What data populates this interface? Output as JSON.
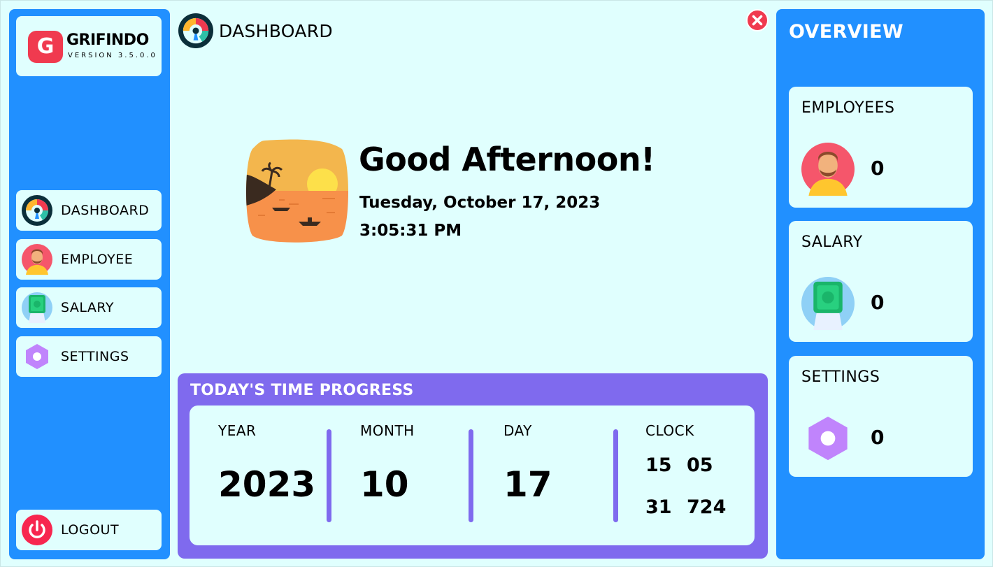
{
  "app": {
    "logo_letter": "G",
    "name": "GRIFINDO",
    "version": "VERSION 3.5.0.0"
  },
  "sidebar": {
    "items": [
      {
        "label": "DASHBOARD",
        "icon": "dashboard-gauge-icon"
      },
      {
        "label": "EMPLOYEE",
        "icon": "employee-avatar-icon"
      },
      {
        "label": "SALARY",
        "icon": "salary-money-icon"
      },
      {
        "label": "SETTINGS",
        "icon": "settings-hexagon-icon"
      }
    ],
    "logout": {
      "label": "LOGOUT",
      "icon": "power-icon"
    }
  },
  "header": {
    "title": "DASHBOARD",
    "close_icon": "close-icon"
  },
  "greeting": {
    "message": "Good Afternoon!",
    "date": "Tuesday, October 17, 2023",
    "time": "3:05:31 PM",
    "icon": "sunset-beach-icon"
  },
  "progress": {
    "title": "TODAY'S TIME PROGRESS",
    "year": {
      "label": "YEAR",
      "value": "2023"
    },
    "month": {
      "label": "MONTH",
      "value": "10"
    },
    "day": {
      "label": "DAY",
      "value": "17"
    },
    "clock": {
      "label": "CLOCK",
      "hour": "15",
      "minute": "05",
      "second": "31",
      "millisecond": "724"
    }
  },
  "overview": {
    "title": "OVERVIEW",
    "cards": [
      {
        "title": "EMPLOYEES",
        "count": "0",
        "icon": "employee-avatar-icon"
      },
      {
        "title": "SALARY",
        "count": "0",
        "icon": "salary-money-icon"
      },
      {
        "title": "SETTINGS",
        "count": "0",
        "icon": "settings-hexagon-icon"
      }
    ]
  },
  "colors": {
    "sidebar_blue": "#2190ff",
    "panel_bg": "#e0fffe",
    "progress_purple": "#7f6aee",
    "accent_red": "#f03a4f"
  }
}
